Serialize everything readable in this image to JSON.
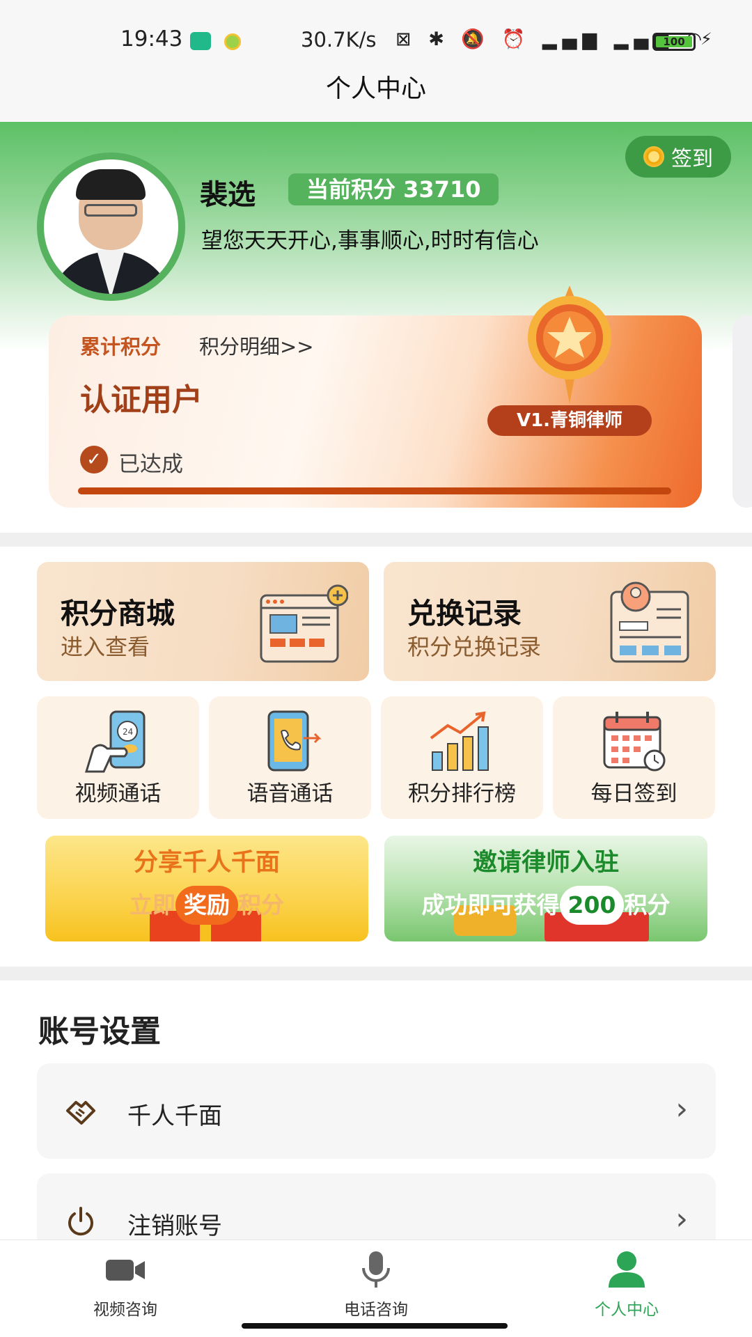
{
  "status_bar": {
    "time": "19:43",
    "speed": "30.7K/s",
    "battery": "100"
  },
  "page_title": "个人中心",
  "profile": {
    "sign_in_label": "签到",
    "name": "裴选",
    "points_label": "当前积分 33710",
    "motto": "望您天天开心,事事顺心,时时有信心"
  },
  "level_card": {
    "label": "累计积分",
    "detail_link": "积分明细>>",
    "title": "认证用户",
    "status": "已达成",
    "progress": 1.0,
    "level_name": "V1.青铜律师"
  },
  "big_tiles": [
    {
      "title": "积分商城",
      "subtitle": "进入查看",
      "icon": "shop-page-icon"
    },
    {
      "title": "兑换记录",
      "subtitle": "积分兑换记录",
      "icon": "record-card-icon"
    }
  ],
  "small_tiles": [
    {
      "label": "视频通话",
      "icon": "video-call-icon"
    },
    {
      "label": "语音通话",
      "icon": "voice-call-icon"
    },
    {
      "label": "积分排行榜",
      "icon": "ranking-chart-icon"
    },
    {
      "label": "每日签到",
      "icon": "calendar-icon"
    }
  ],
  "banners": {
    "share": {
      "title": "分享千人千面",
      "pre": "立即",
      "highlight": "奖励",
      "post": "积分"
    },
    "invite": {
      "title": "邀请律师入驻",
      "pre": "成功即可获得",
      "highlight": "200",
      "post": "积分"
    }
  },
  "settings": {
    "title": "账号设置",
    "items": [
      {
        "label": "千人千面",
        "icon": "handshake-icon"
      },
      {
        "label": "注销账号",
        "icon": "power-icon"
      }
    ]
  },
  "bottom_nav": [
    {
      "label": "视频咨询",
      "icon": "video-camera-icon",
      "active": false
    },
    {
      "label": "电话咨询",
      "icon": "microphone-icon",
      "active": false
    },
    {
      "label": "个人中心",
      "icon": "person-icon",
      "active": true
    }
  ],
  "colors": {
    "brand_green": "#55b35d",
    "active_nav": "#2da556",
    "level_accent": "#c4460f"
  }
}
